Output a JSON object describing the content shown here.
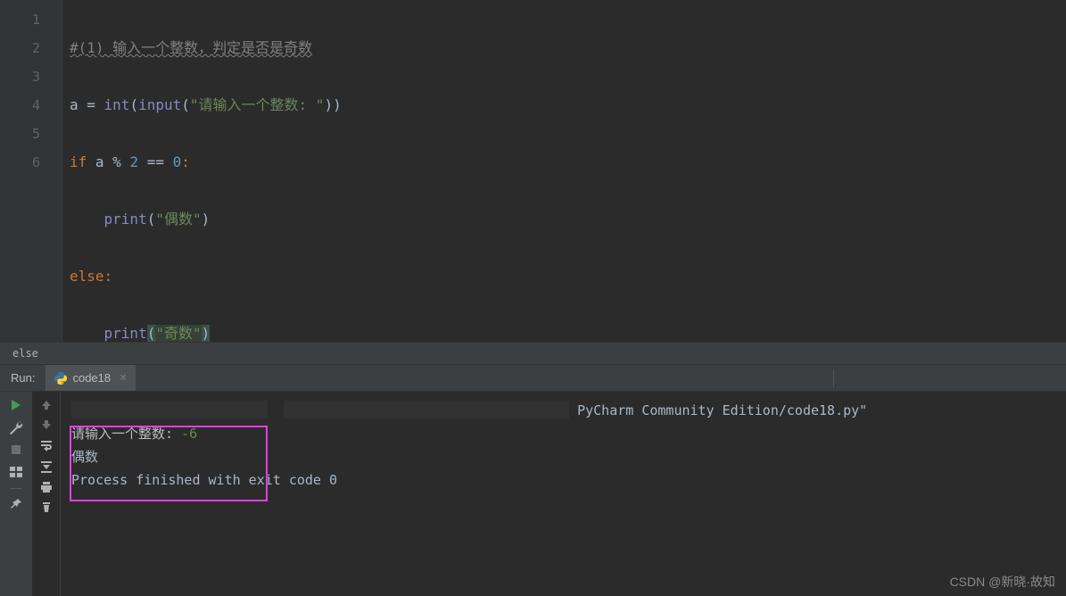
{
  "editor": {
    "line_numbers": [
      "1",
      "2",
      "3",
      "4",
      "5",
      "6"
    ],
    "code": {
      "l1_comment": "#(1) 输入一个整数，判定是否是奇数",
      "l2_a": "a = ",
      "l2_int": "int",
      "l2_p1": "(",
      "l2_input": "input",
      "l2_p2": "(",
      "l2_str": "\"请输入一个整数: \"",
      "l2_p3": "))",
      "l3_if": "if",
      "l3_cond1": " a % ",
      "l3_two": "2",
      "l3_eq": " == ",
      "l3_zero": "0",
      "l3_colon": ":",
      "l4_indent": "    ",
      "l4_print": "print",
      "l4_p1": "(",
      "l4_str": "\"偶数\"",
      "l4_p2": ")",
      "l5_else": "else",
      "l5_colon": ":",
      "l6_indent": "    ",
      "l6_print": "print",
      "l6_p1": "(",
      "l6_str": "\"奇数\"",
      "l6_p2": ")"
    }
  },
  "breadcrumb": "else",
  "run": {
    "label": "Run:",
    "tab_name": "code18"
  },
  "console": {
    "path_suffix": " PyCharm Community Edition/code18.py\"",
    "prompt": "请输入一个整数: ",
    "user_input": "-6",
    "output": "偶数",
    "blank": "",
    "exit": "Process finished with exit code 0"
  },
  "watermark": "CSDN @新晓·故知"
}
